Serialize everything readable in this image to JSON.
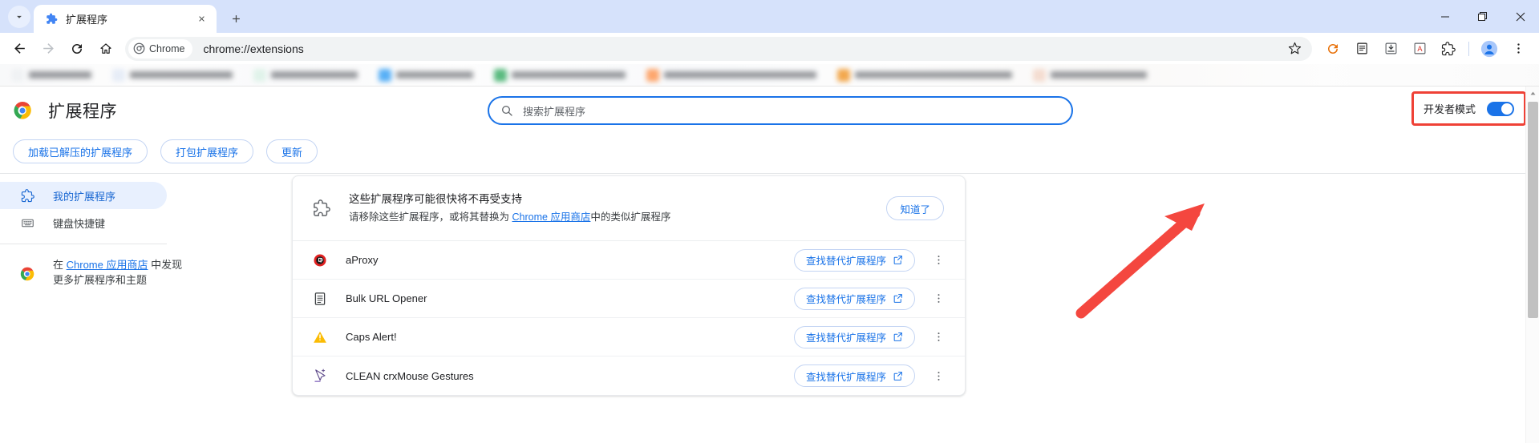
{
  "browser": {
    "tab": {
      "title": "扩展程序",
      "favicon": "puzzle-icon",
      "close": "×"
    },
    "tab_search": "chevron-down-icon",
    "new_tab": "+",
    "window_controls": {
      "minimize": "—",
      "maximize": "□",
      "close": "✕"
    },
    "omnibox": {
      "chip_label": "Chrome",
      "url": "chrome://extensions",
      "bookmark_icon": "star-icon"
    },
    "toolbar_icons": [
      "back-icon",
      "forward-icon",
      "reload-icon",
      "home-icon",
      "sync-icon",
      "reading-list-icon",
      "downloads-icon",
      "translate-icon",
      "extensions-puzzle-icon",
      "profile-avatar-icon",
      "chrome-menu-icon"
    ],
    "accent": "#1a73e8",
    "tabstrip_bg": "#d6e2fb"
  },
  "page": {
    "title": "扩展程序",
    "logo": "chrome-logo-icon",
    "search": {
      "placeholder": "搜索扩展程序",
      "icon": "search-icon",
      "value": ""
    },
    "dev_mode": {
      "label": "开发者模式",
      "enabled": true,
      "highlight_color": "#ef4136"
    },
    "actions": [
      {
        "label": "加载已解压的扩展程序",
        "name": "load-unpacked-button"
      },
      {
        "label": "打包扩展程序",
        "name": "pack-extension-button"
      },
      {
        "label": "更新",
        "name": "update-button"
      }
    ],
    "sidebar": {
      "items": [
        {
          "label": "我的扩展程序",
          "icon": "puzzle-icon",
          "active": true
        },
        {
          "label": "键盘快捷键",
          "icon": "keyboard-icon",
          "active": false
        }
      ],
      "store": {
        "prefix": "在 ",
        "link": "Chrome 应用商店",
        "suffix": " 中发现更多扩展程序和主题",
        "icon": "chrome-webstore-icon"
      }
    },
    "banner": {
      "icon": "puzzle-outline-icon",
      "line1": "这些扩展程序可能很快将不再受支持",
      "line2_prefix": "请移除这些扩展程序，或将其替换为 ",
      "line2_link": "Chrome 应用商店",
      "line2_suffix": "中的类似扩展程序",
      "dismiss_label": "知道了"
    },
    "extension_rows": [
      {
        "name": "aProxy",
        "icon": "aproxy-icon",
        "action_label": "查找替代扩展程序",
        "action_icon": "open-in-new-icon",
        "menu_icon": "kebab-menu-icon"
      },
      {
        "name": "Bulk URL Opener",
        "icon": "document-icon",
        "action_label": "查找替代扩展程序",
        "action_icon": "open-in-new-icon",
        "menu_icon": "kebab-menu-icon"
      },
      {
        "name": "Caps Alert!",
        "icon": "warning-triangle-icon",
        "action_label": "查找替代扩展程序",
        "action_icon": "open-in-new-icon",
        "menu_icon": "kebab-menu-icon"
      },
      {
        "name": "CLEAN crxMouse Gestures",
        "icon": "cursor-icon",
        "action_label": "查找替代扩展程序",
        "action_icon": "open-in-new-icon",
        "menu_icon": "kebab-menu-icon"
      }
    ],
    "annotation": {
      "type": "arrow",
      "color": "#f4473f",
      "points_to": "开发者模式"
    },
    "scrollbar": {
      "up_icon": "scroll-up-icon"
    }
  }
}
